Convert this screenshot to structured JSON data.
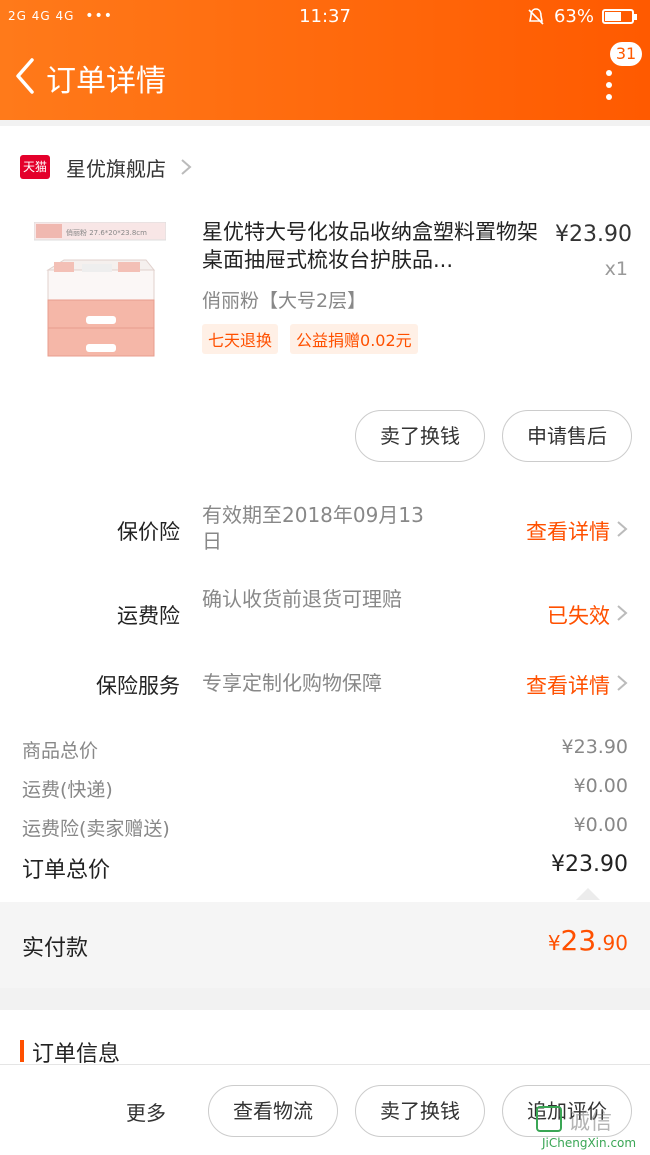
{
  "status_bar": {
    "signal": "2G 4G 4G",
    "dots": "•••",
    "time": "11:37",
    "battery": "63%",
    "battery_level": 0.63
  },
  "header": {
    "title": "订单详情",
    "badge_count": "31"
  },
  "store": {
    "badge": "天猫",
    "name": "星优旗舰店"
  },
  "product": {
    "image_caption": "俏丽粉  27.6*20*23.8cm",
    "title": "星优特大号化妆品收纳盒塑料置物架桌面抽屉式梳妆台护肤品...",
    "price": "¥23.90",
    "quantity": "x1",
    "sku": "俏丽粉【大号2层】",
    "tags": [
      "七天退换",
      "公益捐赠0.02元"
    ]
  },
  "item_actions": {
    "sell_label": "卖了换钱",
    "after_sale_label": "申请售后"
  },
  "insurance": [
    {
      "label": "保价险",
      "desc": "有效期至2018年09月13日",
      "action": "查看详情"
    },
    {
      "label": "运费险",
      "desc": "确认收货前退货可理赔",
      "action": "已失效"
    },
    {
      "label": "保险服务",
      "desc": "专享定制化购物保障",
      "action": "查看详情"
    }
  ],
  "summary": [
    {
      "label": "商品总价",
      "value": "¥23.90"
    },
    {
      "label": "运费(快递)",
      "value": "¥0.00"
    },
    {
      "label": "运费险(卖家赠送)",
      "value": "¥0.00"
    }
  ],
  "total": {
    "label": "订单总价",
    "value": "¥23.90"
  },
  "paid": {
    "label": "实付款",
    "currency": "¥",
    "integer": "23",
    "decimal": ".90"
  },
  "order_info": {
    "title": "订单信息"
  },
  "bottom": {
    "more": "更多",
    "logistics": "查看物流",
    "sell": "卖了换钱",
    "review": "追加评价"
  },
  "watermark": {
    "cn": "诚信",
    "en": "JiChengXin.com"
  },
  "colors": {
    "accent": "#ff5000",
    "header": "#ff6a00",
    "tmall": "#e4002b"
  }
}
